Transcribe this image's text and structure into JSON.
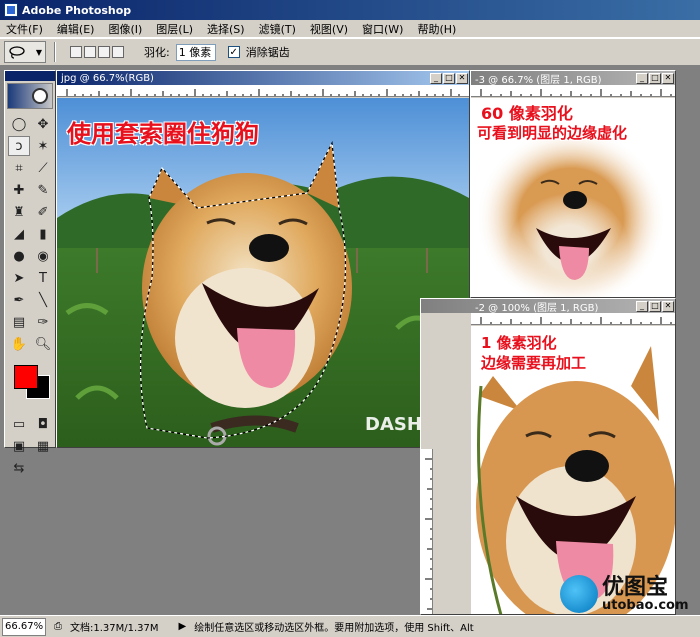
{
  "app": {
    "title": "Adobe Photoshop"
  },
  "menu": [
    "文件(F)",
    "编辑(E)",
    "图像(I)",
    "图层(L)",
    "选择(S)",
    "滤镜(T)",
    "视图(V)",
    "窗口(W)",
    "帮助(H)"
  ],
  "options": {
    "feather_label": "羽化:",
    "feather_value": "1 像素",
    "antialias_label": "消除锯齿",
    "antialias_checked": true
  },
  "tools": [
    "marquee-icon",
    "move-icon",
    "lasso-icon",
    "magic-wand-icon",
    "crop-icon",
    "slice-icon",
    "healing-brush-icon",
    "brush-icon",
    "clone-stamp-icon",
    "history-brush-icon",
    "eraser-icon",
    "gradient-icon",
    "blur-icon",
    "dodge-icon",
    "path-select-icon",
    "type-icon",
    "pen-icon",
    "line-shape-icon",
    "notes-icon",
    "eyedropper-icon",
    "hand-icon",
    "zoom-icon"
  ],
  "colors": {
    "foreground": "#ff0000",
    "background": "#000000"
  },
  "windows": {
    "main": {
      "title": "jpg @ 66.7%(RGB)",
      "annotation": "使用套索圈住狗狗",
      "watermark_text": "DASH村"
    },
    "feather60": {
      "title": "-3 @ 66.7% (图层 1, RGB)",
      "annotation_line1": "60 像素羽化",
      "annotation_line2": "可看到明显的边缘虚化"
    },
    "feather1": {
      "title": "-2 @ 100% (图层 1, RGB)",
      "annotation_line1": "1 像素羽化",
      "annotation_line2": "边缘需要再加工"
    }
  },
  "status": {
    "zoom": "66.67%",
    "doc": "文档:1.37M/1.37M",
    "hint": "绘制任意选区或移动选区外框。要用附加选项，使用 Shift、Alt"
  },
  "watermark": {
    "cn": "优图宝",
    "url": "utobao.com"
  }
}
